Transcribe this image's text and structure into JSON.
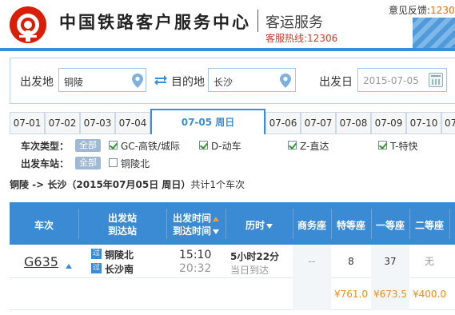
{
  "header": {
    "site_title": "中国铁路客户服务中心",
    "subtitle": "客运服务",
    "hotline": "客服热线:12306",
    "feedback_label": "意见反馈:",
    "feedback_value": "1230"
  },
  "search": {
    "from_label": "出发地",
    "from_value": "铜陵",
    "to_label": "目的地",
    "to_value": "长沙",
    "date_label": "出发日",
    "date_value": "2015-07-05"
  },
  "date_tabs": [
    "07-01",
    "07-02",
    "07-03",
    "07-04",
    "07-05  周日",
    "07-06",
    "07-07",
    "07-08",
    "07-09",
    "07-10",
    "07-"
  ],
  "active_tab_index": 4,
  "filters": {
    "train_type_label": "车次类型：",
    "all_label": "全部",
    "train_types": [
      {
        "label": "GC-高铁/城际",
        "checked": true
      },
      {
        "label": "D-动车",
        "checked": true
      },
      {
        "label": "Z-直达",
        "checked": true
      },
      {
        "label": "T-特快",
        "checked": true
      }
    ],
    "station_label": "出发车站：",
    "station_all_label": "全部",
    "stations": [
      {
        "label": "铜陵北",
        "checked": false
      }
    ]
  },
  "summary": {
    "route": "铜陵 -> 长沙（2015年07月05日  周日）",
    "count_text": "共计1个车次"
  },
  "table": {
    "headers": {
      "train": "车次",
      "station_1": "出发站",
      "station_2": "到达站",
      "time_1": "出发时间",
      "time_2": "到达时间",
      "duration": "历时",
      "business": "商务座",
      "premium": "特等座",
      "first": "一等座",
      "second": "二等座"
    },
    "row": {
      "train_no": "G635",
      "pass_tag": "过",
      "from_station": "铜陵北",
      "to_station": "长沙南",
      "depart": "15:10",
      "arrive": "20:32",
      "duration": "5小时22分",
      "arrive_note": "当日到达",
      "business": "--",
      "premium": "8",
      "first": "37",
      "second": "无"
    },
    "prices": {
      "premium": "¥761.0",
      "first": "¥673.5",
      "second": "¥400.0"
    }
  },
  "colors": {
    "accent": "#3b8fd9",
    "brand_red": "#d81e06",
    "price": "#f08c1c"
  },
  "icons": [
    "railway-logo-icon",
    "location-pin-icon",
    "swap-icon",
    "calendar-icon",
    "checkbox-icon",
    "sort-arrow-icon"
  ]
}
